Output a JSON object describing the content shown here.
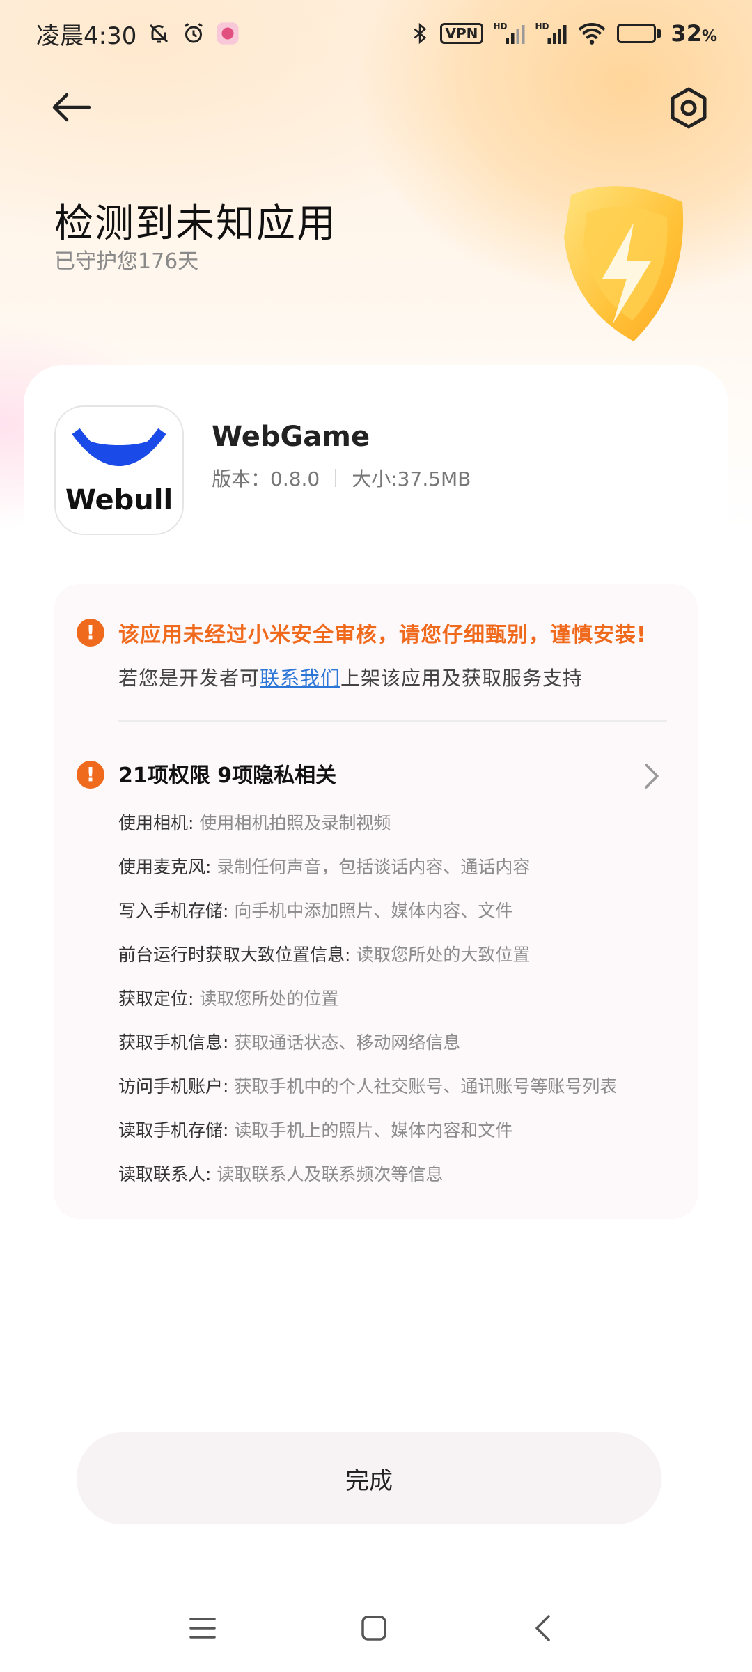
{
  "status_bar": {
    "time": "凌晨4:30",
    "vpn": "VPN",
    "signal_label": "HD",
    "battery": "32",
    "battery_unit": "%"
  },
  "header": {
    "title": "检测到未知应用",
    "subtitle": "已守护您176天"
  },
  "app": {
    "name": "WebGame",
    "icon_text": "Webull",
    "version": "版本：0.8.0",
    "size": "大小:37.5MB"
  },
  "warning": {
    "title": "该应用未经过小米安全审核，请您仔细甄别，谨慎安装!",
    "dev_prefix": "若您是开发者可",
    "dev_link": "联系我们",
    "dev_suffix": "上架该应用及获取服务支持"
  },
  "permissions": {
    "title": "21项权限 9项隐私相关",
    "items": [
      {
        "name": "使用相机: ",
        "desc": "使用相机拍照及录制视频"
      },
      {
        "name": "使用麦克风: ",
        "desc": "录制任何声音，包括谈话内容、通话内容"
      },
      {
        "name": "写入手机存储: ",
        "desc": "向手机中添加照片、媒体内容、文件"
      },
      {
        "name": "前台运行时获取大致位置信息: ",
        "desc": "读取您所处的大致位置"
      },
      {
        "name": "获取定位: ",
        "desc": "读取您所处的位置"
      },
      {
        "name": "获取手机信息: ",
        "desc": "获取通话状态、移动网络信息"
      },
      {
        "name": "访问手机账户: ",
        "desc": "获取手机中的个人社交账号、通讯账号等账号列表"
      },
      {
        "name": "读取手机存储: ",
        "desc": "读取手机上的照片、媒体内容和文件"
      },
      {
        "name": "读取联系人: ",
        "desc": "读取联系人及联系频次等信息"
      }
    ]
  },
  "done_label": "完成",
  "colors": {
    "warning": "#f06a1d",
    "link": "#2b76d6",
    "webull_blue": "#1a4be8",
    "battery_green": "#55c43d"
  },
  "icons": [
    "back-arrow-icon",
    "settings-icon",
    "shield-lightning-icon",
    "warning-icon",
    "chevron-right-icon",
    "menu-icon",
    "home-icon",
    "back-icon"
  ]
}
